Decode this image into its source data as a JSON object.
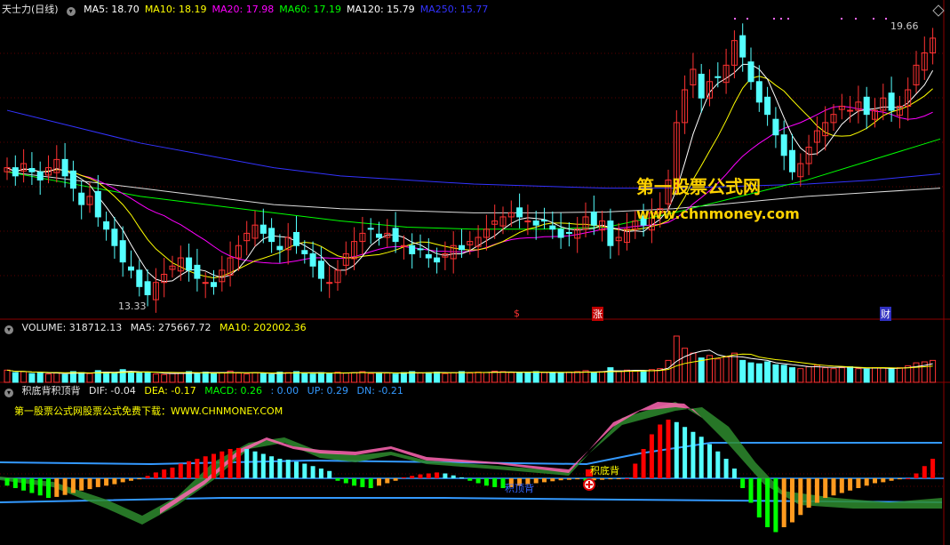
{
  "price_panel": {
    "title": "天士力(日线)",
    "ma": [
      {
        "label": "MA5: 18.70",
        "color": "#ffffff"
      },
      {
        "label": "MA10: 18.19",
        "color": "#ffff00"
      },
      {
        "label": "MA20: 17.98",
        "color": "#ff00ff"
      },
      {
        "label": "MA60: 17.19",
        "color": "#00ff00"
      },
      {
        "label": "MA120: 15.79",
        "color": "#ffffff"
      },
      {
        "label": "MA250: 15.77",
        "color": "#3333ff"
      }
    ],
    "high_label": "19.66",
    "low_label": "13.33",
    "markers": [
      "$",
      "涨",
      "财"
    ]
  },
  "volume_panel": {
    "label": "VOLUME: 318712.13",
    "ma5": "MA5: 275667.72",
    "ma10": "MA10: 202002.36"
  },
  "indicator_panel": {
    "title": "积底背积顶背",
    "dif": "DIF: -0.04",
    "dea": "DEA: -0.17",
    "macd": "MACD: 0.26",
    "zero": ": 0.00",
    "up": "UP: 0.29",
    "dn": "DN: -0.21",
    "promo": "第一股票公式网股票公式免费下载：WWW.CHNMONEY.COM",
    "signal_top": "积底背",
    "signal_bottom": "积顶背"
  },
  "watermark": {
    "line1": "第一股票公式网",
    "line2": "www.chnmoney.com"
  },
  "colors": {
    "up": "#ff3232",
    "down": "#54ffff",
    "ma5": "#ffffff",
    "ma10": "#ffff00",
    "ma20": "#ff00ff",
    "ma60": "#00ff00",
    "ma250": "#3333ff",
    "macd_pos": "#ff0000",
    "macd_neg": "#00ff00",
    "band": "#3399ff"
  },
  "chart_data": {
    "type": "candlestick",
    "y_range": [
      13.0,
      20.2
    ],
    "closes": [
      16.5,
      16.3,
      16.6,
      16.4,
      16.2,
      16.5,
      16.7,
      16.3,
      16.0,
      15.6,
      15.8,
      15.3,
      15.0,
      14.6,
      14.2,
      14.0,
      13.6,
      13.4,
      13.7,
      13.9,
      14.1,
      14.3,
      14.0,
      13.8,
      13.7,
      13.6,
      14.0,
      14.3,
      14.6,
      14.9,
      15.1,
      14.9,
      14.7,
      14.5,
      14.8,
      14.6,
      14.4,
      14.1,
      13.8,
      13.7,
      14.0,
      14.4,
      14.7,
      14.9,
      15.0,
      14.8,
      14.9,
      14.7,
      14.6,
      14.4,
      14.5,
      14.3,
      14.2,
      14.4,
      14.6,
      14.5,
      14.7,
      14.8,
      15.0,
      15.2,
      15.3,
      15.4,
      15.3,
      15.2,
      15.1,
      15.2,
      15.0,
      14.8,
      14.9,
      15.0,
      15.3,
      15.1,
      15.2,
      14.6,
      14.8,
      15.0,
      15.2,
      15.1,
      15.4,
      15.5,
      16.2,
      17.6,
      18.4,
      18.9,
      18.2,
      18.6,
      18.7,
      19.0,
      19.6,
      19.2,
      18.6,
      18.1,
      17.8,
      17.3,
      16.8,
      16.4,
      16.6,
      17.0,
      17.4,
      17.6,
      17.8,
      18.0,
      17.9,
      18.1,
      17.8,
      17.9,
      18.2,
      17.9,
      18.0,
      18.4,
      19.0,
      19.3,
      19.66
    ],
    "ma250": [
      17.9,
      17.5,
      17.1,
      16.8,
      16.5,
      16.3,
      16.2,
      16.1,
      16.05,
      16.0,
      16.0,
      16.05,
      16.1,
      16.2,
      16.35
    ],
    "ma120": [
      16.4,
      16.2,
      16.0,
      15.8,
      15.6,
      15.5,
      15.45,
      15.4,
      15.4,
      15.42,
      15.5,
      15.65,
      15.8,
      15.9,
      16.0
    ],
    "ma60": [
      16.4,
      16.1,
      15.8,
      15.6,
      15.4,
      15.2,
      15.05,
      15.0,
      15.0,
      15.05,
      15.4,
      15.8,
      16.2,
      16.7,
      17.2
    ],
    "volume": [
      0.25,
      0.2,
      0.22,
      0.18,
      0.2,
      0.17,
      0.19,
      0.16,
      0.22,
      0.2,
      0.18,
      0.24,
      0.21,
      0.2,
      0.26,
      0.22,
      0.19,
      0.2,
      0.17,
      0.16,
      0.18,
      0.2,
      0.22,
      0.19,
      0.21,
      0.18,
      0.2,
      0.23,
      0.19,
      0.17,
      0.2,
      0.18,
      0.16,
      0.21,
      0.2,
      0.22,
      0.19,
      0.17,
      0.2,
      0.18,
      0.21,
      0.19,
      0.2,
      0.22,
      0.18,
      0.2,
      0.19,
      0.17,
      0.2,
      0.22,
      0.19,
      0.2,
      0.21,
      0.18,
      0.2,
      0.22,
      0.19,
      0.21,
      0.2,
      0.23,
      0.22,
      0.2,
      0.19,
      0.21,
      0.22,
      0.2,
      0.2,
      0.19,
      0.21,
      0.22,
      0.24,
      0.2,
      0.22,
      0.3,
      0.22,
      0.25,
      0.24,
      0.22,
      0.26,
      0.28,
      0.45,
      0.95,
      0.7,
      0.6,
      0.5,
      0.55,
      0.48,
      0.52,
      0.6,
      0.45,
      0.4,
      0.38,
      0.42,
      0.36,
      0.35,
      0.3,
      0.28,
      0.32,
      0.35,
      0.3,
      0.28,
      0.3,
      0.32,
      0.28,
      0.27,
      0.3,
      0.29,
      0.28,
      0.3,
      0.34,
      0.4,
      0.42,
      0.45
    ],
    "macd": [
      -0.15,
      -0.2,
      -0.25,
      -0.3,
      -0.35,
      -0.4,
      -0.38,
      -0.34,
      -0.3,
      -0.25,
      -0.22,
      -0.18,
      -0.15,
      -0.12,
      -0.08,
      -0.05,
      -0.02,
      0.05,
      0.12,
      0.18,
      0.22,
      0.3,
      0.35,
      0.4,
      0.45,
      0.5,
      0.55,
      0.6,
      0.62,
      0.6,
      0.55,
      0.5,
      0.45,
      0.4,
      0.38,
      0.34,
      0.3,
      0.25,
      0.2,
      0.15,
      -0.05,
      -0.1,
      -0.15,
      -0.18,
      -0.2,
      -0.15,
      -0.1,
      -0.05,
      0.02,
      0.05,
      0.08,
      0.1,
      0.12,
      0.1,
      0.06,
      0.02,
      -0.05,
      -0.1,
      -0.15,
      -0.18,
      -0.2,
      -0.18,
      -0.15,
      -0.12,
      -0.1,
      -0.08,
      -0.06,
      -0.04,
      -0.03,
      -0.02,
      -0.05,
      -0.04,
      -0.03,
      -0.02,
      -0.01,
      0.0,
      0.3,
      0.6,
      0.9,
      1.1,
      1.2,
      1.15,
      1.05,
      0.95,
      0.85,
      0.7,
      0.55,
      0.4,
      0.2,
      -0.2,
      -0.5,
      -0.8,
      -1.0,
      -1.1,
      -1.0,
      -0.9,
      -0.75,
      -0.6,
      -0.5,
      -0.4,
      -0.35,
      -0.3,
      -0.25,
      -0.2,
      -0.15,
      -0.1,
      -0.08,
      -0.05,
      -0.02,
      0.0,
      0.1,
      0.25,
      0.4
    ]
  }
}
